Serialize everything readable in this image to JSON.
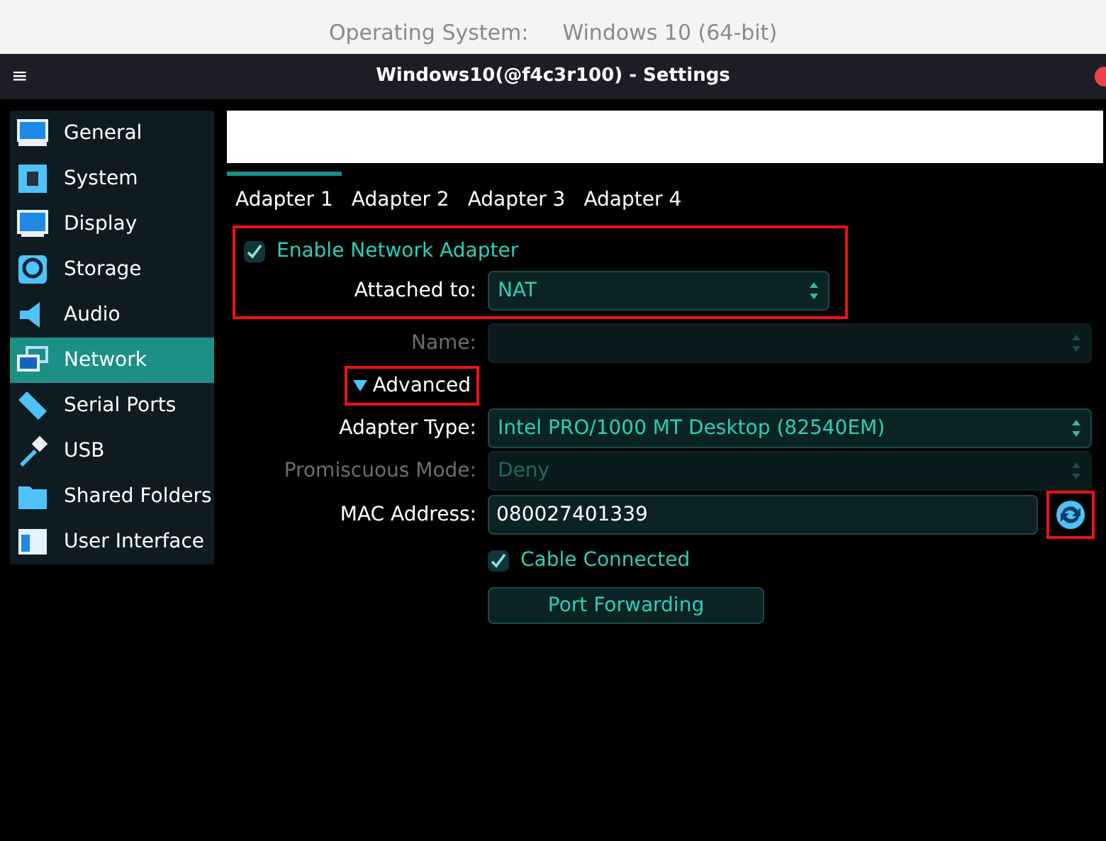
{
  "background_window": {
    "label": "Operating System:",
    "value": "Windows 10 (64-bit)"
  },
  "window": {
    "title": "Windows10(@f4c3r100) - Settings",
    "menu_glyph": "≡"
  },
  "sidebar": {
    "items": [
      {
        "label": "General",
        "selected": false
      },
      {
        "label": "System",
        "selected": false
      },
      {
        "label": "Display",
        "selected": false
      },
      {
        "label": "Storage",
        "selected": false
      },
      {
        "label": "Audio",
        "selected": false
      },
      {
        "label": "Network",
        "selected": true
      },
      {
        "label": "Serial Ports",
        "selected": false
      },
      {
        "label": "USB",
        "selected": false
      },
      {
        "label": "Shared Folders",
        "selected": false
      },
      {
        "label": "User Interface",
        "selected": false
      }
    ]
  },
  "tabs": [
    {
      "label": "Adapter 1",
      "selected": true
    },
    {
      "label": "Adapter 2",
      "selected": false
    },
    {
      "label": "Adapter 3",
      "selected": false
    },
    {
      "label": "Adapter 4",
      "selected": false
    }
  ],
  "enable_adapter": {
    "label": "Enable Network Adapter",
    "checked": true,
    "highlighted": true
  },
  "fields": [
    {
      "kind": "select",
      "label": "Attached to:",
      "value": "NAT",
      "disabled": false
    },
    {
      "kind": "select",
      "label": "Name:",
      "disabled": true
    },
    {
      "kind": "expander",
      "label": "Advanced",
      "expanded": true,
      "highlighted": true
    },
    {
      "kind": "select",
      "label": "Adapter Type:",
      "value": "Intel PRO/1000 MT Desktop (82540EM)",
      "disabled": false
    },
    {
      "kind": "select",
      "label": "Promiscuous Mode:",
      "value": "Deny",
      "disabled": true
    },
    {
      "kind": "mac",
      "label": "MAC Address:",
      "value": "080027401339",
      "disabled": false,
      "highlighted": true
    },
    {
      "kind": "checkbox",
      "label": "Cable Connected",
      "checked": true,
      "disabled": false
    },
    {
      "kind": "button",
      "label": "Port Forwarding",
      "disabled": false
    }
  ]
}
